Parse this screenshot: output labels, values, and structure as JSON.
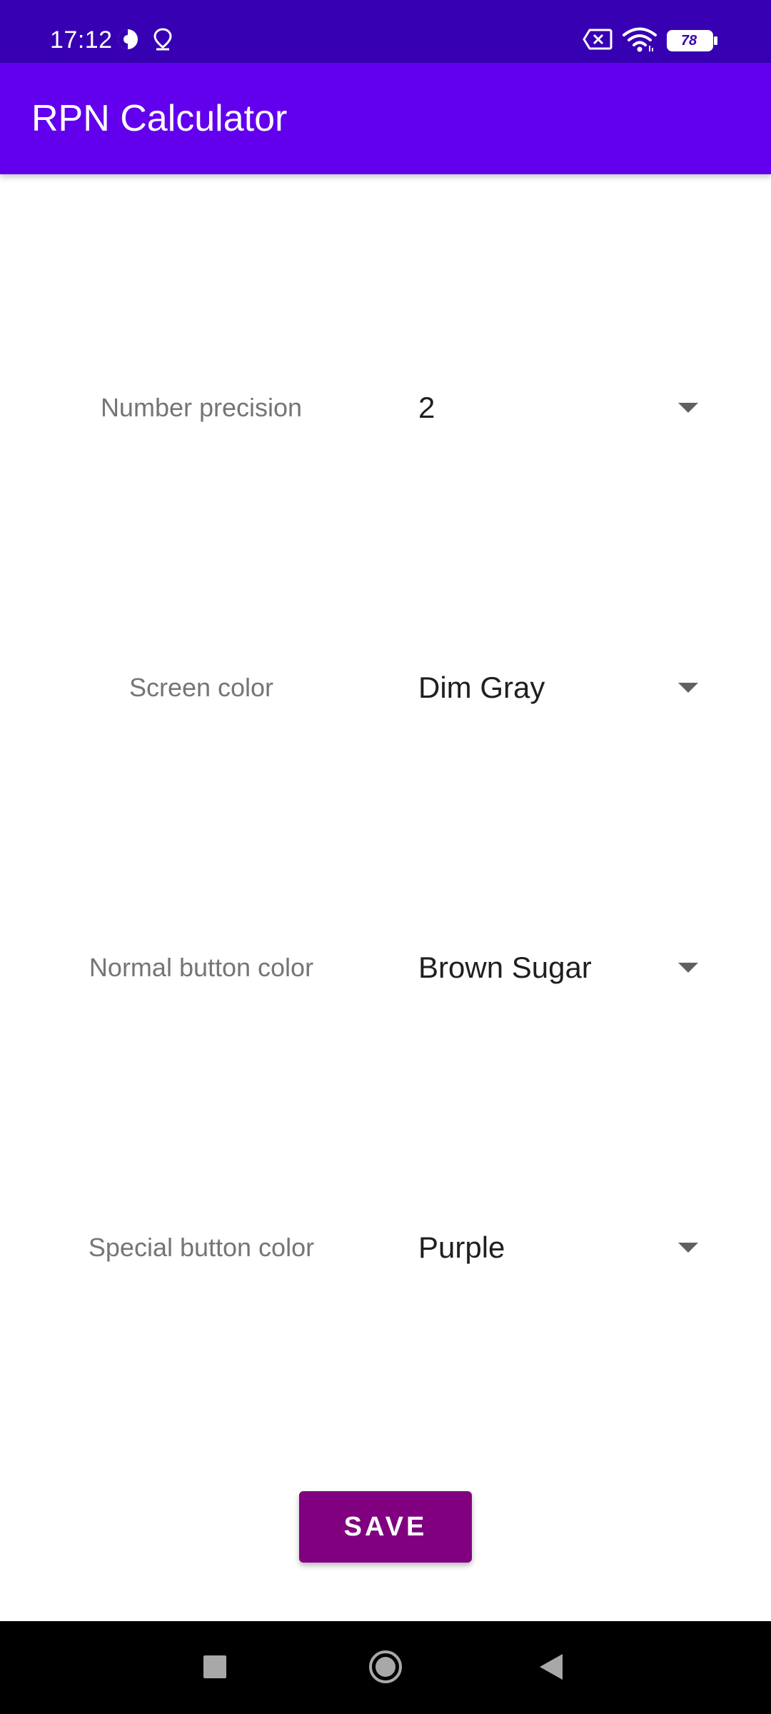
{
  "status_bar": {
    "time": "17:12",
    "battery_level": "78",
    "icons": [
      "data-saver-icon",
      "location-icon",
      "sim-no-signal-icon",
      "wifi-icon",
      "battery-icon"
    ]
  },
  "app_bar": {
    "title": "RPN Calculator"
  },
  "settings": [
    {
      "label": "Number precision",
      "value": "2"
    },
    {
      "label": "Screen color",
      "value": "Dim Gray"
    },
    {
      "label": "Normal button color",
      "value": "Brown Sugar"
    },
    {
      "label": "Special button color",
      "value": "Purple"
    }
  ],
  "save_button": {
    "label": "SAVE"
  },
  "nav_bar": {
    "icons": [
      "recents-icon",
      "home-icon",
      "back-icon"
    ]
  },
  "colors": {
    "status_bar": "#3700b3",
    "app_bar": "#6200ee",
    "save_button": "#800080",
    "label_text": "#757575",
    "value_text": "#1f1f1f"
  }
}
